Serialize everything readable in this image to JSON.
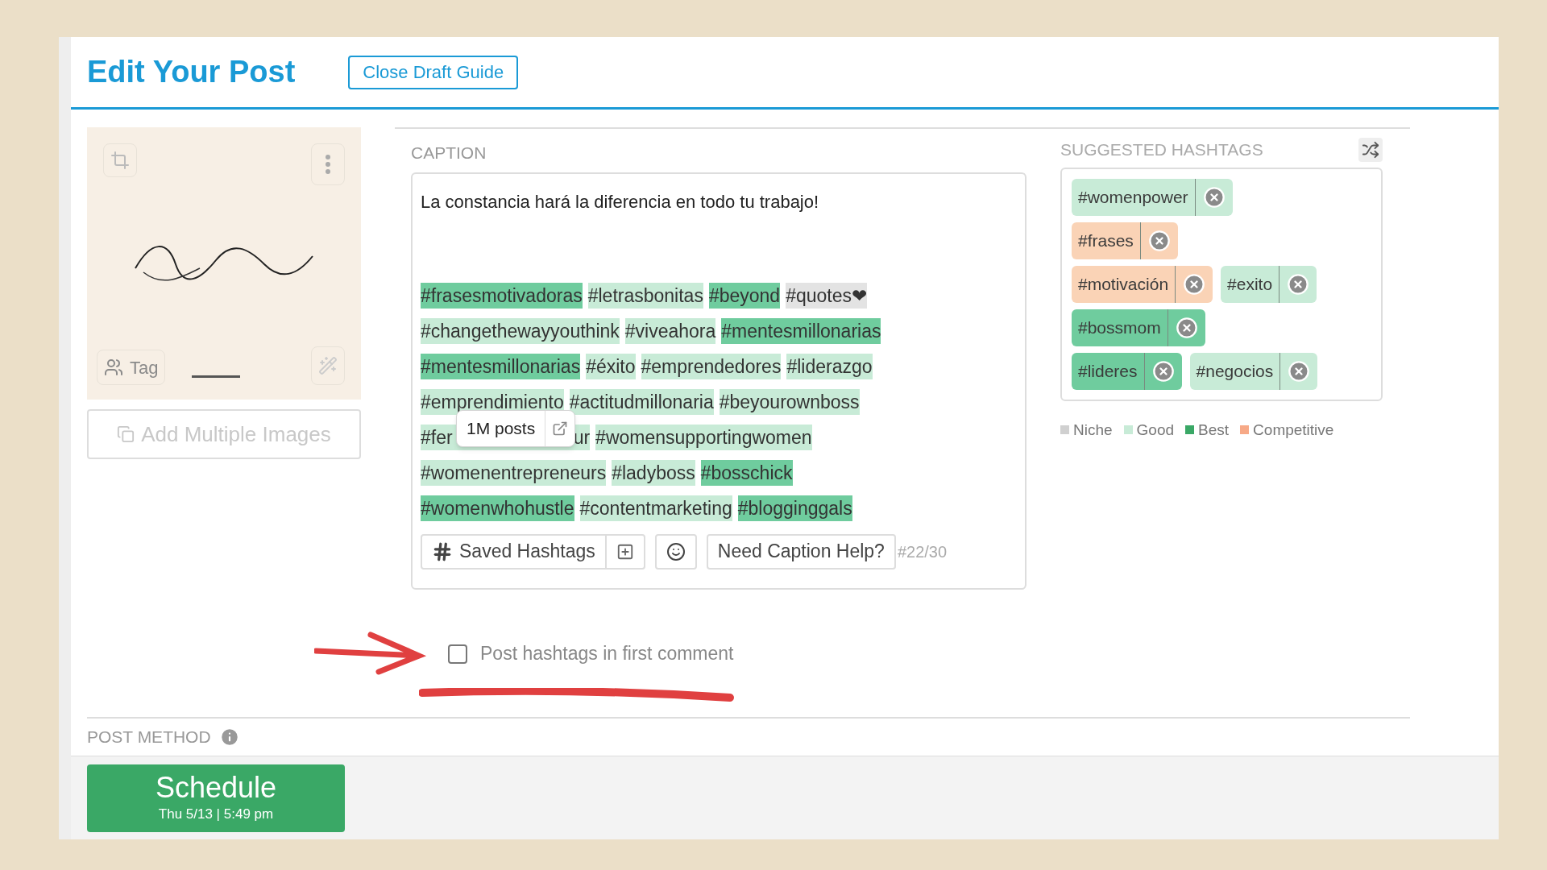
{
  "header": {
    "title": "Edit Your Post",
    "guide_button": "Close Draft Guide"
  },
  "media": {
    "tag_button": "Tag",
    "add_images_button": "Add Multiple Images"
  },
  "caption": {
    "label": "CAPTION",
    "text": "La constancia hará la diferencia en todo tu trabajo!",
    "hashtags": [
      {
        "text": "#frasesmotivadoras",
        "kind": "best"
      },
      {
        "text": "#letrasbonitas",
        "kind": "good"
      },
      {
        "text": "#beyond",
        "kind": "best"
      },
      {
        "text": "#quotes❤",
        "kind": "niche"
      },
      {
        "text": "#changethewayyouthink",
        "kind": "good"
      },
      {
        "text": "#viveahora",
        "kind": "good"
      },
      {
        "text": "#mentesmillonarias",
        "kind": "best"
      },
      {
        "text": "#mentesmillonarias",
        "kind": "best"
      },
      {
        "text": "#éxito",
        "kind": "good"
      },
      {
        "text": "#emprendedores",
        "kind": "good"
      },
      {
        "text": "#liderazgo",
        "kind": "good"
      },
      {
        "text": "#emprendimiento",
        "kind": "good"
      },
      {
        "text": "#actitudmillonaria",
        "kind": "good"
      },
      {
        "text": "#beyourownboss",
        "kind": "good"
      },
      {
        "text": "#fer",
        "text_end": "ur",
        "kind": "good",
        "tooltip": {
          "text": "1M posts"
        }
      },
      {
        "text": "#womensupportingwomen",
        "kind": "good"
      },
      {
        "text": "#womenentrepreneurs",
        "kind": "good"
      },
      {
        "text": "#ladyboss",
        "kind": "good"
      },
      {
        "text": "#bosschick",
        "kind": "best"
      },
      {
        "text": "#womenwhohustle",
        "kind": "best"
      },
      {
        "text": "#contentmarketing",
        "kind": "good"
      },
      {
        "text": "#blogginggals",
        "kind": "best"
      }
    ],
    "saved_hashtags_button": "Saved Hashtags",
    "caption_help_button": "Need Caption Help?",
    "count": "#22/30"
  },
  "suggested": {
    "label": "SUGGESTED HASHTAGS",
    "tags": [
      {
        "text": "#womenpower",
        "kind": "good"
      },
      {
        "text": "#frases",
        "kind": "competitive"
      },
      {
        "text": "#motivación",
        "kind": "competitive"
      },
      {
        "text": "#exito",
        "kind": "good"
      },
      {
        "text": "#bossmom",
        "kind": "best"
      },
      {
        "text": "#lideres",
        "kind": "best"
      },
      {
        "text": "#negocios",
        "kind": "good"
      }
    ],
    "legend": [
      {
        "label": "Niche",
        "kind": "niche"
      },
      {
        "label": "Good",
        "kind": "good"
      },
      {
        "label": "Best",
        "kind": "best"
      },
      {
        "label": "Competitive",
        "kind": "competitive"
      }
    ]
  },
  "first_comment": {
    "label": "Post hashtags in first comment",
    "checked": false
  },
  "post_method": {
    "label": "POST METHOD"
  },
  "schedule": {
    "label": "Schedule",
    "time": "Thu 5/13 | 5:49 pm"
  }
}
